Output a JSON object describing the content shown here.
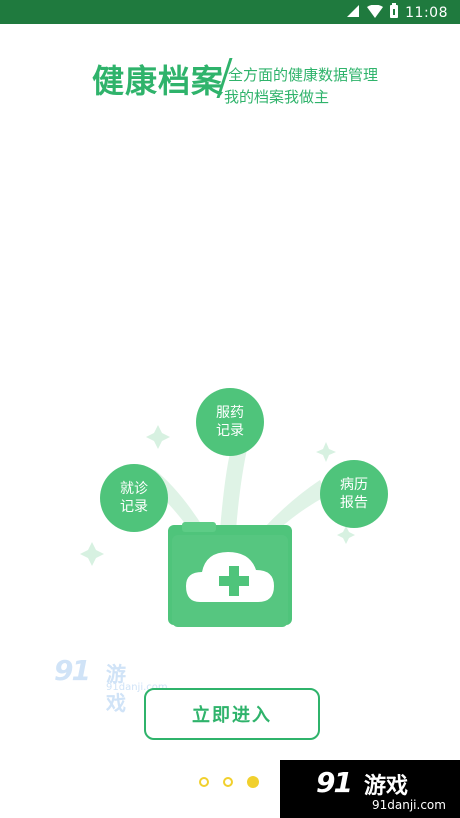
{
  "statusbar": {
    "time": "11:08"
  },
  "header": {
    "title": "健康档案",
    "subtitle_line1": "全方面的健康数据管理",
    "subtitle_line2": "我的档案我做主"
  },
  "illustration": {
    "bubbles": [
      {
        "label_line1": "就诊",
        "label_line2": "记录"
      },
      {
        "label_line1": "服药",
        "label_line2": "记录"
      },
      {
        "label_line1": "病历",
        "label_line2": "报告"
      }
    ]
  },
  "actions": {
    "enter_label": "立即进入"
  },
  "pager": {
    "count": 3,
    "active_index": 2
  },
  "watermark": {
    "number": "91",
    "name": "游戏",
    "url": "91danji.com"
  },
  "colors": {
    "status_bar": "#1f7a3e",
    "brand_green": "#2fb36b",
    "bubble_green": "#4fc47b",
    "pager_yellow": "#f1d02d"
  }
}
